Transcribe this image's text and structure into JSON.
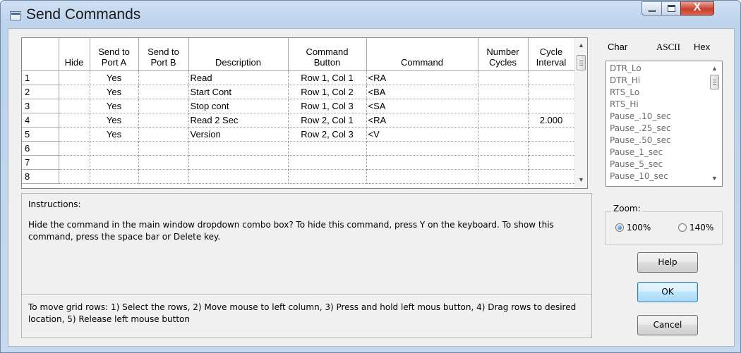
{
  "window": {
    "title": "Send Commands",
    "close_glyph": "X"
  },
  "grid": {
    "columns": [
      "",
      "Hide",
      "Send to Port A",
      "Send to Port B",
      "Description",
      "Command Button",
      "Command",
      "Number Cycles",
      "Cycle Interval"
    ],
    "header_lines": {
      "hide": "Hide",
      "port_a_1": "Send to",
      "port_a_2": "Port A",
      "port_b_1": "Send to",
      "port_b_2": "Port B",
      "description": "Description",
      "cmdbtn_1": "Command",
      "cmdbtn_2": "Button",
      "command": "Command",
      "cycles_1": "Number",
      "cycles_2": "Cycles",
      "interval_1": "Cycle",
      "interval_2": "Interval"
    },
    "rows": [
      {
        "num": "1",
        "hide": "",
        "port_a": "Yes",
        "port_b": "",
        "description": "Read",
        "button": "Row 1, Col 1",
        "command": "<RA",
        "cycles": "",
        "interval": ""
      },
      {
        "num": "2",
        "hide": "",
        "port_a": "Yes",
        "port_b": "",
        "description": "Start Cont",
        "button": "Row 1, Col 2",
        "command": "<BA",
        "cycles": "",
        "interval": ""
      },
      {
        "num": "3",
        "hide": "",
        "port_a": "Yes",
        "port_b": "",
        "description": "Stop cont",
        "button": "Row 1, Col 3",
        "command": "<SA",
        "cycles": "",
        "interval": ""
      },
      {
        "num": "4",
        "hide": "",
        "port_a": "Yes",
        "port_b": "",
        "description": "Read 2 Sec",
        "button": "Row 2, Col 1",
        "command": "<RA",
        "cycles": "",
        "interval": "2.000"
      },
      {
        "num": "5",
        "hide": "",
        "port_a": "Yes",
        "port_b": "",
        "description": "Version",
        "button": "Row 2, Col 3",
        "command": "<V",
        "cycles": "",
        "interval": ""
      },
      {
        "num": "6",
        "hide": "",
        "port_a": "",
        "port_b": "",
        "description": "",
        "button": "",
        "command": "",
        "cycles": "",
        "interval": ""
      },
      {
        "num": "7",
        "hide": "",
        "port_a": "",
        "port_b": "",
        "description": "",
        "button": "",
        "command": "",
        "cycles": "",
        "interval": ""
      },
      {
        "num": "8",
        "hide": "",
        "port_a": "",
        "port_b": "",
        "description": "",
        "button": "",
        "command": "",
        "cycles": "",
        "interval": ""
      }
    ]
  },
  "char_list": {
    "headers": {
      "char": "Char",
      "ascii": "ASCII",
      "hex": "Hex"
    },
    "items": [
      "DTR_Lo",
      "DTR_Hi",
      "RTS_Lo",
      "RTS_Hi",
      "Pause_.10_sec",
      "Pause_.25_sec",
      "Pause_.50_sec",
      "Pause_1_sec",
      "Pause_5_sec",
      "Pause_10_sec"
    ]
  },
  "instructions": {
    "label": "Instructions:",
    "text": "Hide the command in the main window dropdown combo box?  To hide this command, press Y on the keyboard.  To show this command, press the space bar or Delete key.",
    "move_text": "To move grid rows:  1) Select the rows,  2) Move mouse to left column,  3) Press and hold left mous button,  4) Drag rows to desired location,  5) Release left mouse button"
  },
  "zoom": {
    "label": "Zoom:",
    "options": [
      "100%",
      "140%"
    ],
    "selected": "100%"
  },
  "buttons": {
    "help": "Help",
    "ok": "OK",
    "cancel": "Cancel"
  },
  "icons": {
    "app": "window-app-icon",
    "minimize": "minimize-icon",
    "maximize": "maximize-icon",
    "close": "close-icon",
    "scroll_up": "scroll-up-arrow-icon",
    "scroll_down": "scroll-down-arrow-icon"
  },
  "colors": {
    "close_button": "#c7402e",
    "titlebar": "#c6d9ee",
    "default_button": "#a7d9f5"
  }
}
